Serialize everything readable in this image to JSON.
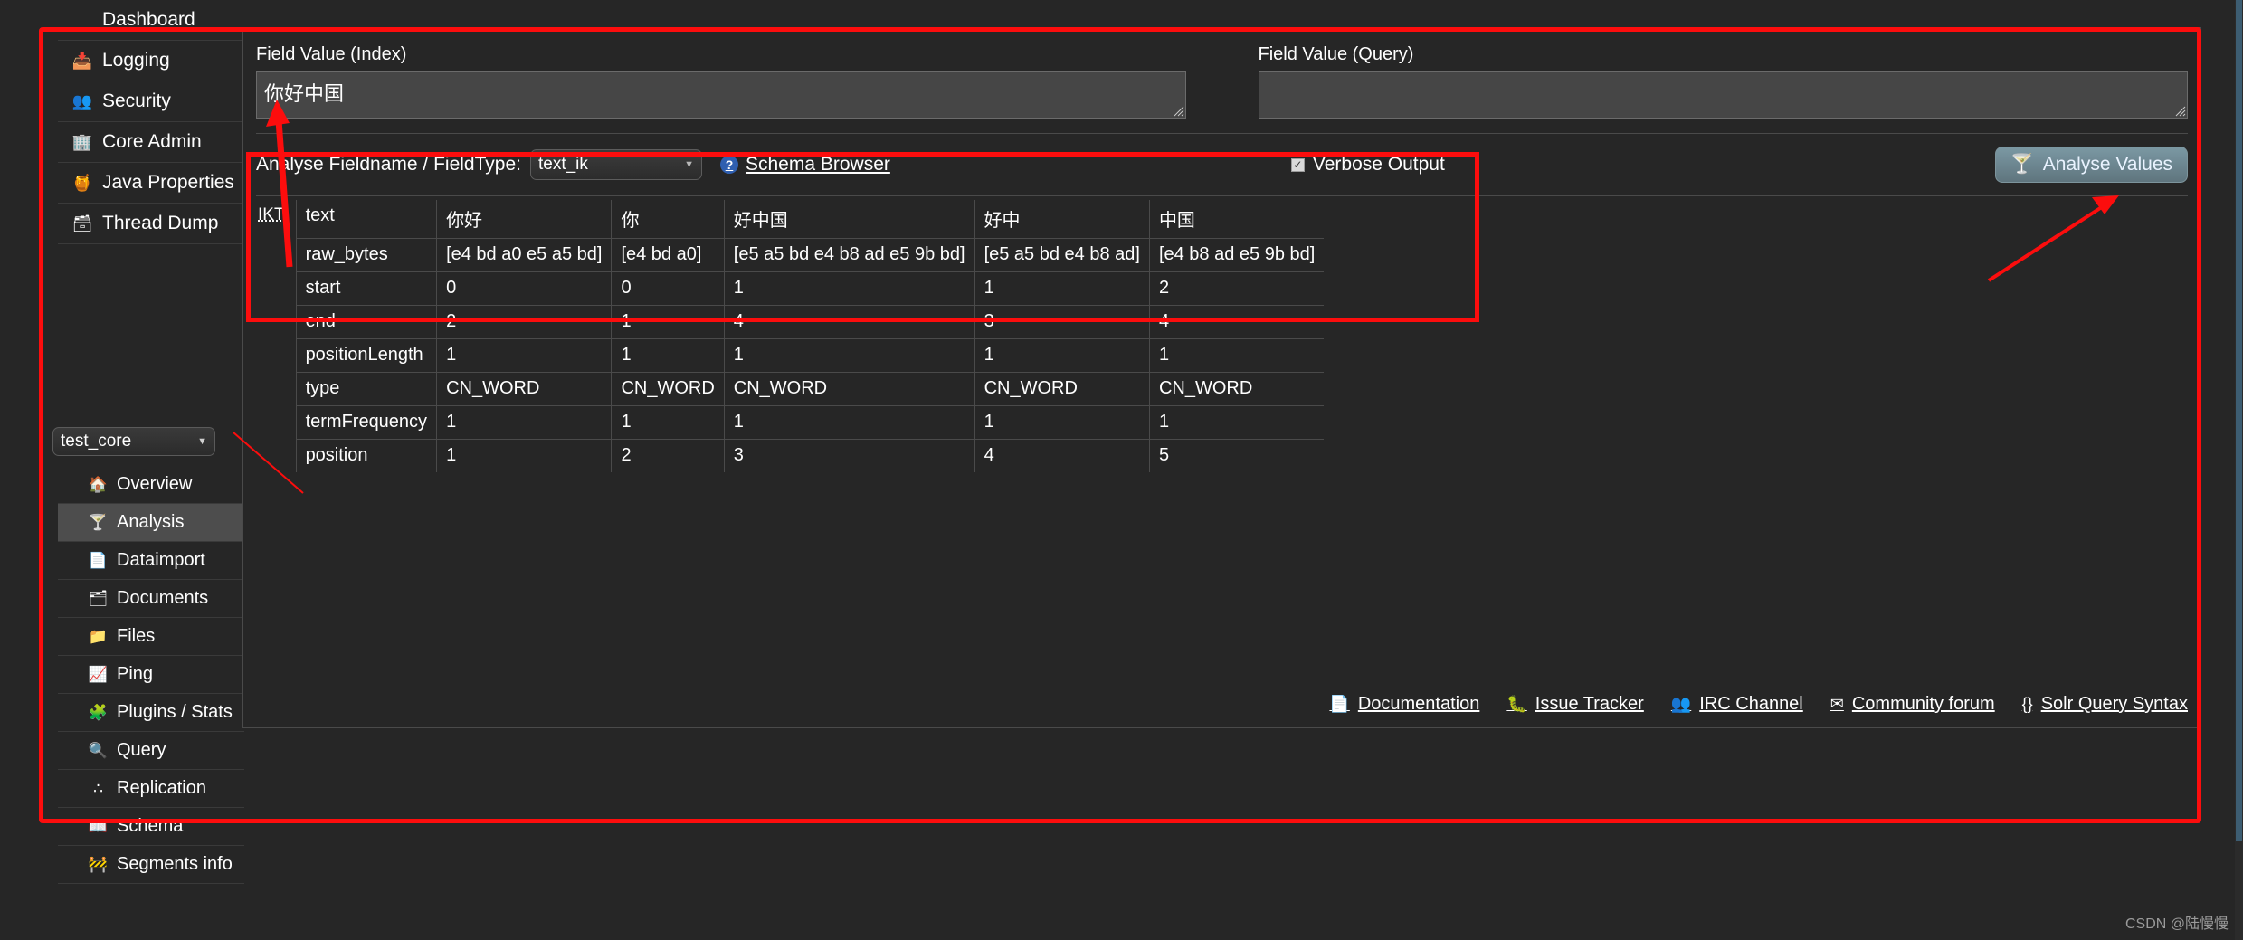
{
  "sidebar": {
    "items": [
      {
        "label": "Dashboard",
        "icon": "",
        "icon_name": "dashboard-icon",
        "active": false,
        "noicon": true
      },
      {
        "label": "Logging",
        "icon": "📥",
        "icon_name": "logging-icon",
        "active": false
      },
      {
        "label": "Security",
        "icon": "👥",
        "icon_name": "security-icon",
        "active": false
      },
      {
        "label": "Core Admin",
        "icon": "🏢",
        "icon_name": "core-admin-icon",
        "active": false
      },
      {
        "label": "Java Properties",
        "icon": "🍯",
        "icon_name": "java-properties-icon",
        "active": false
      },
      {
        "label": "Thread Dump",
        "icon": "🗃",
        "icon_name": "thread-dump-icon",
        "active": false
      }
    ],
    "core_selector": {
      "value": "test_core",
      "caret": "▼"
    },
    "sub_items": [
      {
        "label": "Overview",
        "icon": "🏠",
        "icon_name": "overview-icon",
        "active": false
      },
      {
        "label": "Analysis",
        "icon": "🍸",
        "icon_name": "analysis-icon",
        "active": true
      },
      {
        "label": "Dataimport",
        "icon": "📄",
        "icon_name": "dataimport-icon",
        "active": false
      },
      {
        "label": "Documents",
        "icon": "🗂",
        "icon_name": "documents-icon",
        "active": false
      },
      {
        "label": "Files",
        "icon": "📁",
        "icon_name": "files-icon",
        "active": false
      },
      {
        "label": "Ping",
        "icon": "📈",
        "icon_name": "ping-icon",
        "active": false
      },
      {
        "label": "Plugins / Stats",
        "icon": "🧩",
        "icon_name": "plugins-stats-icon",
        "active": false
      },
      {
        "label": "Query",
        "icon": "🔍",
        "icon_name": "query-icon",
        "active": false
      },
      {
        "label": "Replication",
        "icon": "∴",
        "icon_name": "replication-icon",
        "active": false
      },
      {
        "label": "Schema",
        "icon": "📖",
        "icon_name": "schema-icon",
        "active": false
      },
      {
        "label": "Segments info",
        "icon": "🚧",
        "icon_name": "segments-info-icon",
        "active": false
      }
    ]
  },
  "main": {
    "field_value_index": {
      "label": "Field Value (Index)",
      "value": "你好中国",
      "placeholder": ""
    },
    "field_value_query": {
      "label": "Field Value (Query)",
      "value": "",
      "placeholder": ""
    },
    "analyse_label": "Analyse Fieldname / FieldType:",
    "fieldtype_select": {
      "value": "text_ik",
      "caret": "▼"
    },
    "schema_browser_link": {
      "label": "Schema Browser",
      "icon": "?"
    },
    "verbose_output": {
      "label": "Verbose Output",
      "checked": true,
      "check_glyph": "✓"
    },
    "analyse_button": {
      "label": "Analyse Values",
      "icon": "🍸"
    }
  },
  "analysis_table": {
    "analyzer_abbr": "IKT",
    "row_keys": [
      "text",
      "raw_bytes",
      "start",
      "end",
      "positionLength",
      "type",
      "termFrequency",
      "position"
    ],
    "tokens": [
      {
        "text": "你好",
        "raw_bytes": "[e4 bd a0 e5 a5 bd]",
        "start": "0",
        "end": "2",
        "positionLength": "1",
        "type": "CN_WORD",
        "termFrequency": "1",
        "position": "1"
      },
      {
        "text": "你",
        "raw_bytes": "[e4 bd a0]",
        "start": "0",
        "end": "1",
        "positionLength": "1",
        "type": "CN_WORD",
        "termFrequency": "1",
        "position": "2"
      },
      {
        "text": "好中国",
        "raw_bytes": "[e5 a5 bd e4 b8 ad e5 9b bd]",
        "start": "1",
        "end": "4",
        "positionLength": "1",
        "type": "CN_WORD",
        "termFrequency": "1",
        "position": "3"
      },
      {
        "text": "好中",
        "raw_bytes": "[e5 a5 bd e4 b8 ad]",
        "start": "1",
        "end": "3",
        "positionLength": "1",
        "type": "CN_WORD",
        "termFrequency": "1",
        "position": "4"
      },
      {
        "text": "中国",
        "raw_bytes": "[e4 b8 ad e5 9b bd]",
        "start": "2",
        "end": "4",
        "positionLength": "1",
        "type": "CN_WORD",
        "termFrequency": "1",
        "position": "5"
      }
    ]
  },
  "footer_links": [
    {
      "label": "Documentation",
      "icon": "📄",
      "icon_name": "documentation-icon"
    },
    {
      "label": "Issue Tracker",
      "icon": "🐛",
      "icon_name": "issue-tracker-icon"
    },
    {
      "label": "IRC Channel",
      "icon": "👥",
      "icon_name": "irc-channel-icon"
    },
    {
      "label": "Community forum",
      "icon": "✉",
      "icon_name": "community-forum-icon"
    },
    {
      "label": "Solr Query Syntax",
      "icon": "{}",
      "icon_name": "solr-query-syntax-icon"
    }
  ],
  "watermark": "CSDN @陆慢慢",
  "colors": {
    "annotation": "#fc0d0d",
    "background": "#262626",
    "panel_border": "#4a4a4a",
    "active_nav": "#4d4d4d",
    "button": "#7b98a3",
    "scrollbar_thumb": "#3d5d72"
  }
}
